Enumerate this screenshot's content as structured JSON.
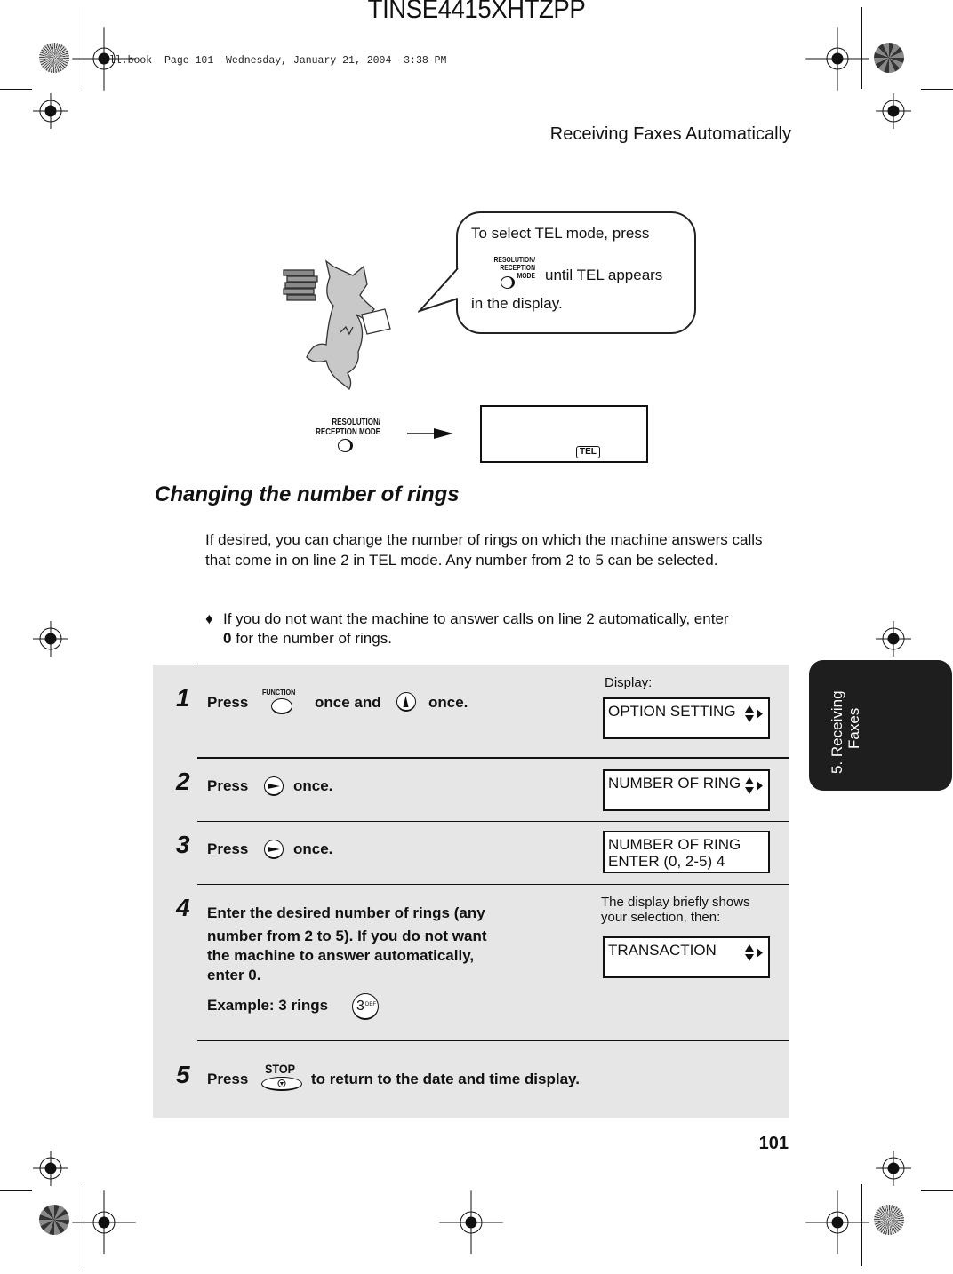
{
  "job_code": "TINSE4415XHTZPP",
  "book_info": "all.book  Page 101  Wednesday, January 21, 2004  3:38 PM",
  "running_head": "Receiving Faxes Automatically",
  "page_number": "101",
  "side_tab": {
    "line1": "5. Receiving",
    "line2": "Faxes"
  },
  "illustration": {
    "mascot": "dog-carrying-books",
    "bubble": {
      "line1": "To select TEL mode, press",
      "button_caption_1": "RESOLUTION/",
      "button_caption_2": "RECEPTION MODE",
      "line2": "until TEL appears",
      "line3": "in the display."
    },
    "button_caption_1": "RESOLUTION/",
    "button_caption_2": "RECEPTION MODE",
    "display_badge": "TEL"
  },
  "section": {
    "title": "Changing the number of rings",
    "body": "If desired, you can change the number of rings on which the machine answers calls that come in on line 2 in TEL mode. Any number from 2 to 5 can be selected.",
    "bullet_symbol": "♦",
    "bullet_bold": "0",
    "bullet_pre": "If you do not want the machine to answer calls on line 2 automatically, enter ",
    "bullet_post": " for the number of rings."
  },
  "steps": [
    {
      "num": "1",
      "press": "Press",
      "button_caption": "FUNCTION",
      "mid": "once and",
      "end": "once.",
      "display_label": "Display:",
      "display": [
        "OPTION SETTING",
        ""
      ]
    },
    {
      "num": "2",
      "press": "Press",
      "end": "once.",
      "display": [
        "NUMBER OF RING",
        ""
      ]
    },
    {
      "num": "3",
      "press": "Press",
      "end": "once.",
      "display": [
        "NUMBER OF RING",
        "ENTER (0, 2-5) 4"
      ]
    },
    {
      "num": "4",
      "lines": [
        "Enter the desired number of rings (any",
        "number from 2 to 5). If you do not want",
        "the machine to answer automatically,",
        "enter 0."
      ],
      "example": "Example: 3 rings",
      "key_digit": "3",
      "key_letters": "DEF",
      "display_label_1": "The display briefly shows",
      "display_label_2": "your selection, then:",
      "display": [
        "TRANSACTION",
        ""
      ]
    },
    {
      "num": "5",
      "press": "Press",
      "button_caption": "STOP",
      "end": "to return to the date and time display."
    }
  ]
}
